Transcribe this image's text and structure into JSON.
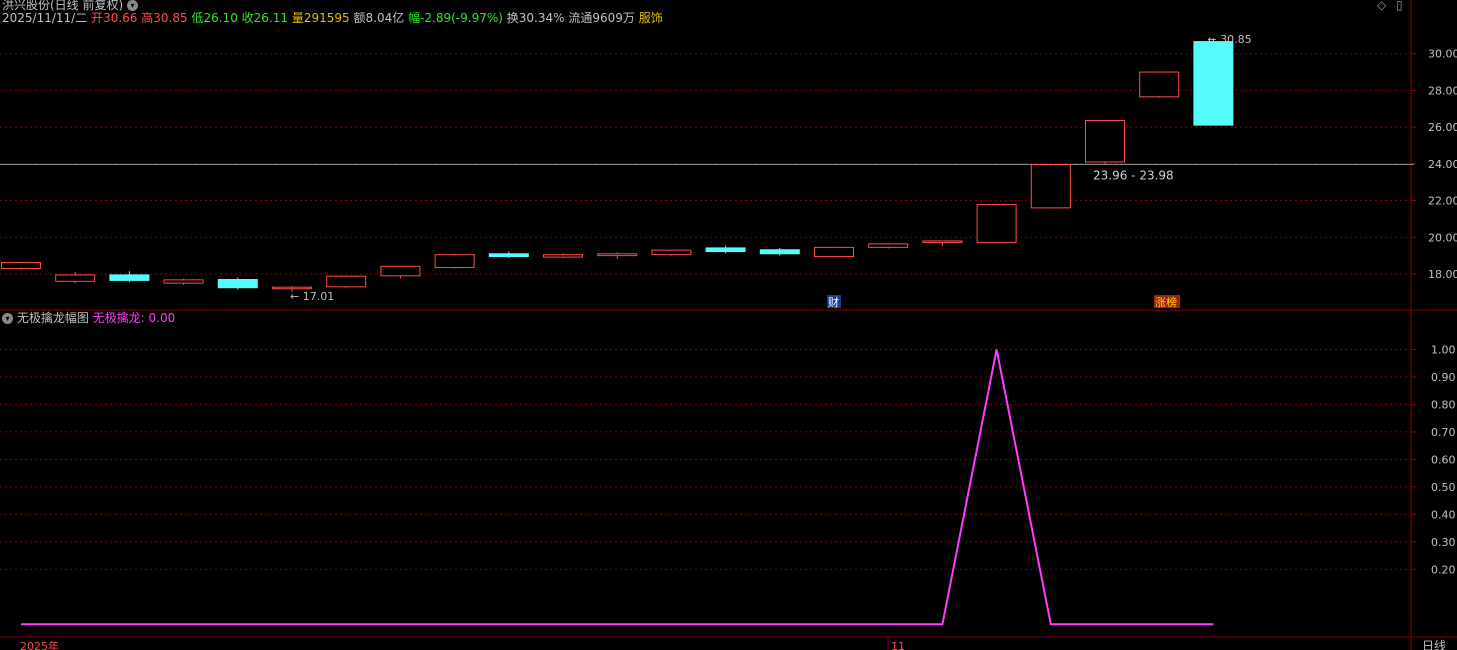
{
  "title": {
    "stock": "洪兴股份(日线 前复权)",
    "date": "2025/11/11/二",
    "open_label": "开",
    "open": "30.66",
    "high_label": "高",
    "high": "30.85",
    "low_label": "低",
    "low": "26.10",
    "close_label": "收",
    "close": "26.11",
    "vol_label": "量",
    "vol": "291595",
    "amount": "额8.04亿",
    "change": "幅-2.89(-9.97%)",
    "turnover": "换30.34%",
    "float": "流通9609万",
    "sector": "服饰"
  },
  "indicator": {
    "name": "无极擒龙幅图",
    "series_label": "无极擒龙:",
    "value": "0.00"
  },
  "colors": {
    "up": "#ff4d4d",
    "down": "#54fcfc",
    "indicator_line": "#ff3cff",
    "grid": "#8b0000",
    "axis_text": "#c0c0c0"
  },
  "markers": {
    "finance": "财",
    "limit_board": "涨榜",
    "crosshair_label": "23.96 - 23.98",
    "high_label": "30.85",
    "low_label": "17.01"
  },
  "footer": {
    "year_label": "2025年",
    "month_label": "11",
    "period_label": "日线"
  },
  "chart_data": [
    {
      "type": "candlestick",
      "ylim": [
        16.8,
        31.4
      ],
      "y_ticks": [
        "18.00",
        "20.00",
        "22.00",
        "24.00",
        "26.00",
        "28.00",
        "30.00"
      ],
      "crosshair_y": 23.97,
      "candles": [
        {
          "o": 18.3,
          "h": 18.68,
          "l": 18.2,
          "c": 18.62
        },
        {
          "o": 17.6,
          "h": 18.1,
          "l": 17.5,
          "c": 17.95
        },
        {
          "o": 17.95,
          "h": 18.15,
          "l": 17.55,
          "c": 17.65
        },
        {
          "o": 17.5,
          "h": 17.75,
          "l": 17.4,
          "c": 17.68
        },
        {
          "o": 17.7,
          "h": 17.8,
          "l": 17.15,
          "c": 17.25
        },
        {
          "o": 17.2,
          "h": 17.35,
          "l": 17.01,
          "c": 17.28
        },
        {
          "o": 17.3,
          "h": 17.85,
          "l": 17.25,
          "c": 17.88
        },
        {
          "o": 17.9,
          "h": 18.45,
          "l": 17.75,
          "c": 18.42
        },
        {
          "o": 18.35,
          "h": 19.1,
          "l": 18.3,
          "c": 19.05
        },
        {
          "o": 19.1,
          "h": 19.22,
          "l": 18.86,
          "c": 18.95
        },
        {
          "o": 18.92,
          "h": 19.12,
          "l": 18.86,
          "c": 19.05
        },
        {
          "o": 19.0,
          "h": 19.18,
          "l": 18.82,
          "c": 19.1
        },
        {
          "o": 19.05,
          "h": 19.32,
          "l": 19.0,
          "c": 19.3
        },
        {
          "o": 19.42,
          "h": 19.55,
          "l": 19.12,
          "c": 19.22
        },
        {
          "o": 19.32,
          "h": 19.42,
          "l": 19.0,
          "c": 19.1
        },
        {
          "o": 18.95,
          "h": 19.48,
          "l": 18.92,
          "c": 19.45
        },
        {
          "o": 19.45,
          "h": 19.68,
          "l": 19.38,
          "c": 19.64
        },
        {
          "o": 19.72,
          "h": 19.82,
          "l": 19.5,
          "c": 19.8
        },
        {
          "o": 19.72,
          "h": 21.8,
          "l": 19.7,
          "c": 21.78
        },
        {
          "o": 21.6,
          "h": 24.0,
          "l": 21.58,
          "c": 23.96
        },
        {
          "o": 24.1,
          "h": 26.36,
          "l": 24.0,
          "c": 26.36
        },
        {
          "o": 27.65,
          "h": 29.0,
          "l": 27.6,
          "c": 29.0
        },
        {
          "o": 30.66,
          "h": 30.85,
          "l": 26.1,
          "c": 26.11
        }
      ]
    },
    {
      "type": "line",
      "name": "无极擒龙",
      "ylim": [
        -0.05,
        1.1
      ],
      "y_ticks": [
        "0.20",
        "0.30",
        "0.40",
        "0.50",
        "0.60",
        "0.70",
        "0.80",
        "0.90",
        "1.00"
      ],
      "values": [
        0,
        0,
        0,
        0,
        0,
        0,
        0,
        0,
        0,
        0,
        0,
        0,
        0,
        0,
        0,
        0,
        0,
        0,
        1,
        0,
        0,
        0,
        0
      ]
    }
  ]
}
